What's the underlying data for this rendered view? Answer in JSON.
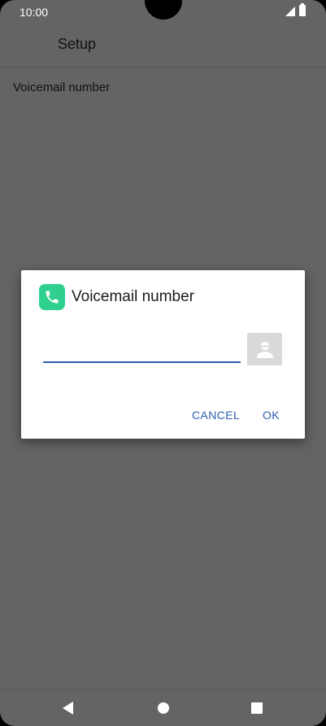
{
  "status_bar": {
    "time": "10:00",
    "signal_icon": "signal-icon",
    "battery_icon": "battery-icon"
  },
  "header": {
    "title": "Setup"
  },
  "preferences": {
    "voicemail_number_label": "Voicemail number"
  },
  "dialog": {
    "icon": "phone-icon",
    "title": "Voicemail number",
    "input_value": "",
    "contact_picker_icon": "contact-icon",
    "cancel_label": "CANCEL",
    "ok_label": "OK",
    "accent_color": "#2e5fb0",
    "app_icon_color": "#2fd08e"
  },
  "nav_bar": {
    "back_icon": "back-icon",
    "home_icon": "home-icon",
    "recents_icon": "recents-icon"
  }
}
